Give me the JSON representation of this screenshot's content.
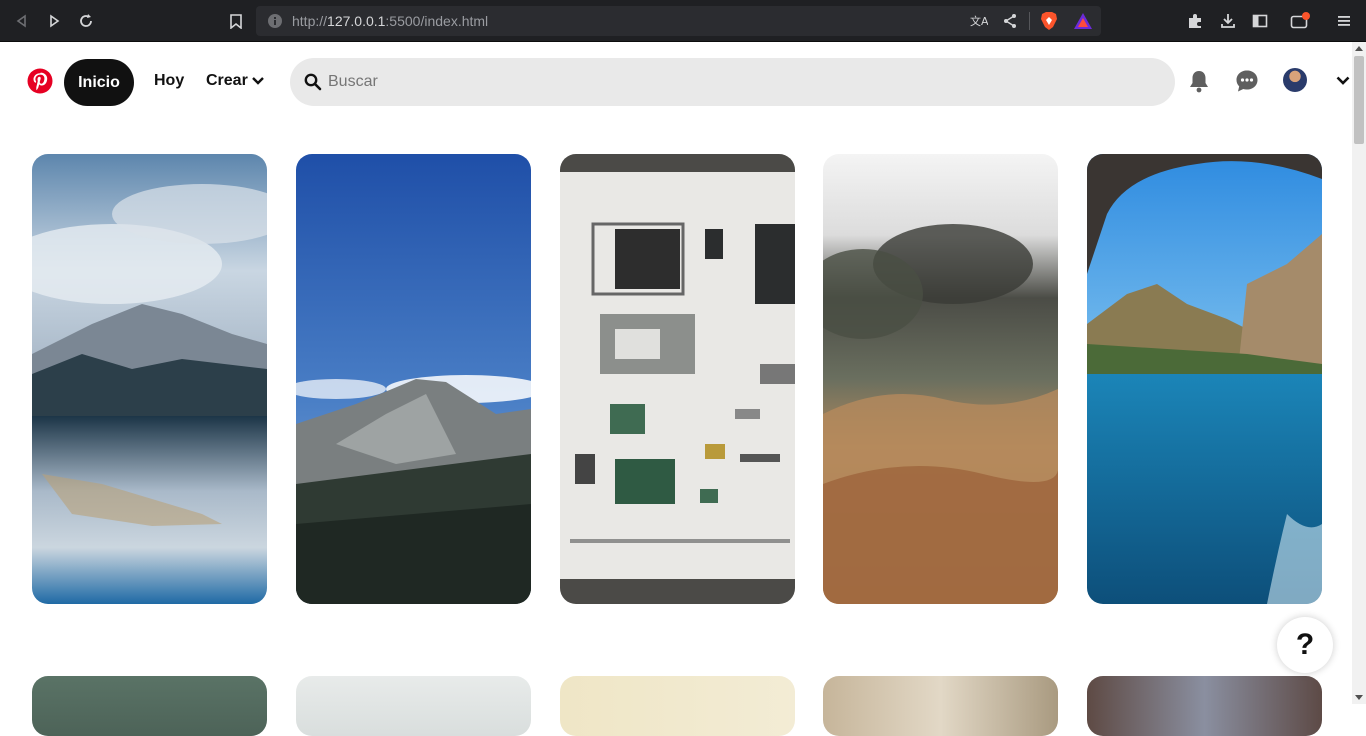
{
  "browser": {
    "url_scheme": "http://",
    "url_host": "127.0.0.1",
    "url_rest": ":5500/index.html"
  },
  "header": {
    "nav": {
      "home_label": "Inicio",
      "today_label": "Hoy",
      "create_label": "Crear"
    },
    "search": {
      "placeholder": "Buscar",
      "value": ""
    },
    "icons": [
      "pinterest-logo-icon",
      "search-icon",
      "bell-icon",
      "chat-icon",
      "avatar",
      "chevron-down-icon"
    ]
  },
  "pins": {
    "row1": [
      {
        "name": "pin-mountain-lake",
        "desc": "mountain lake"
      },
      {
        "name": "pin-mountain-forest",
        "desc": "mountain forest"
      },
      {
        "name": "pin-camera-parts",
        "desc": "camera parts"
      },
      {
        "name": "pin-dry-grass",
        "desc": "dry grass"
      },
      {
        "name": "pin-sea-cave",
        "desc": "sea cave"
      }
    ]
  },
  "help": {
    "label": "?"
  },
  "colors": {
    "brand_red": "#e60023",
    "active_nav_bg": "#111111",
    "search_bg": "#e9e9e9"
  }
}
